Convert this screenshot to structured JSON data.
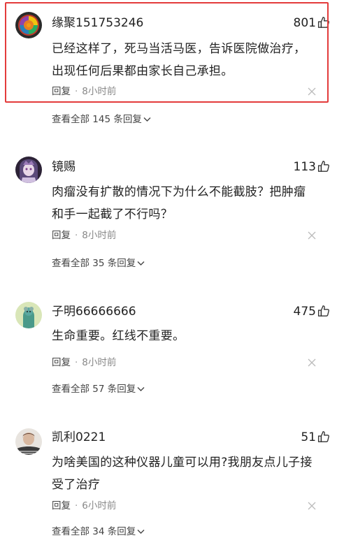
{
  "comments": [
    {
      "username": "缘聚151753246",
      "likes": "801",
      "text_lines": [
        "已经这样了，死马当活马医，告诉医院做治疗，",
        "出现任何后果都由家长自己承担。"
      ],
      "reply_label": "回复",
      "time": "8小时前",
      "view_replies": "查看全部 145 条回复",
      "avatar_icon": "rose-avatar-icon",
      "highlighted": true
    },
    {
      "username": "镜赐",
      "likes": "113",
      "text_lines": [
        "肉瘤没有扩散的情况下为什么不能截肢？把肿瘤",
        "和手一起截了不行吗？"
      ],
      "reply_label": "回复",
      "time": "8小时前",
      "view_replies": "查看全部 35 条回复",
      "avatar_icon": "anime-character-avatar-icon"
    },
    {
      "username": "子明66666666",
      "likes": "475",
      "text_lines": [
        "生命重要。红线不重要。"
      ],
      "reply_label": "回复",
      "time": "8小时前",
      "view_replies": "查看全部 57 条回复",
      "avatar_icon": "cartoon-avatar-icon"
    },
    {
      "username": "凯利0221",
      "likes": "51",
      "text_lines": [
        "为啥美国的这种仪器儿童可以用?我朋友点儿子接",
        "受了治疗"
      ],
      "reply_label": "回复",
      "time": "6小时前",
      "view_replies": "查看全部 34 条回复",
      "avatar_icon": "photo-avatar-icon"
    }
  ],
  "colors": {
    "highlight_border": "#e33b3b",
    "text_primary": "#222222",
    "text_secondary": "#888888"
  }
}
